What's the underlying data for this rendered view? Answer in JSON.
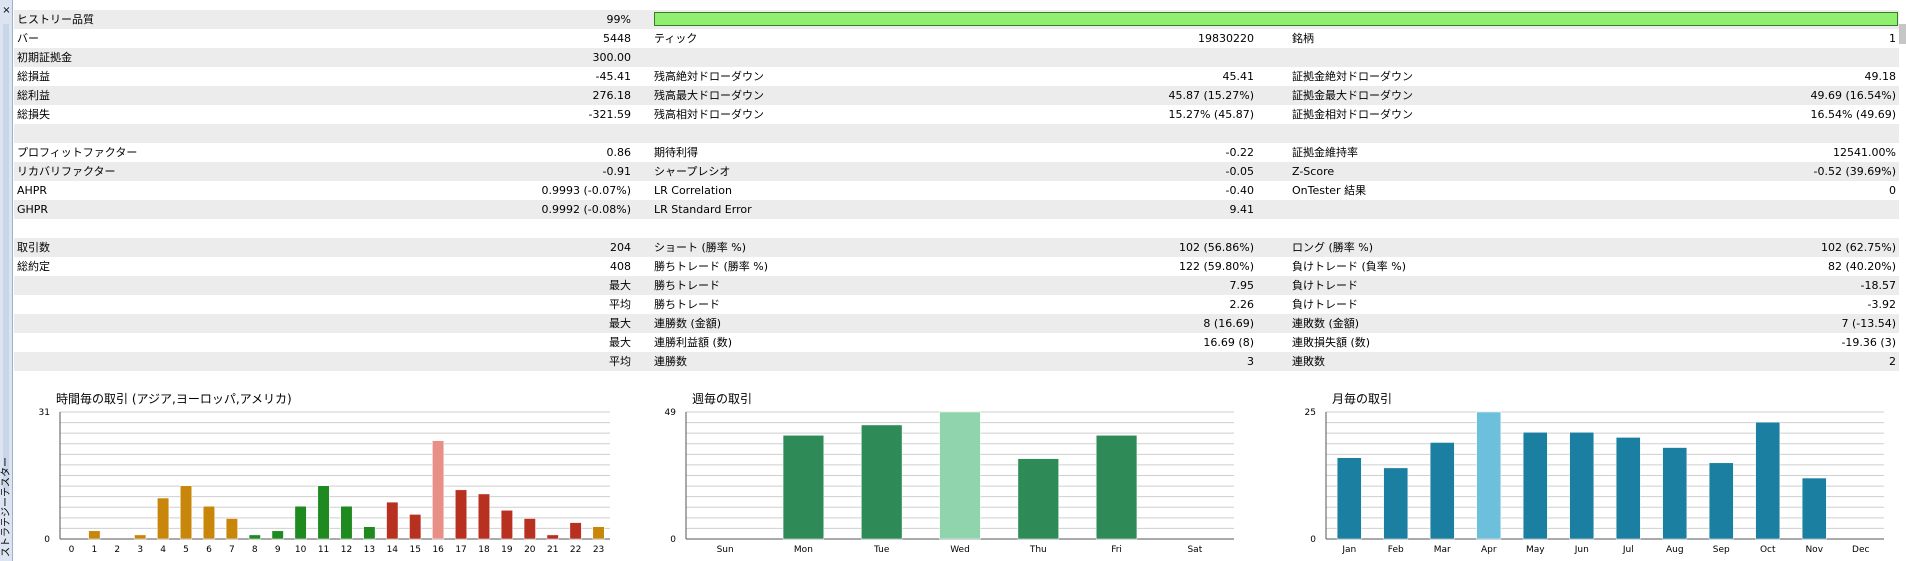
{
  "panel": {
    "title": "ストラテジーテスター",
    "close": "×"
  },
  "stats": [
    {
      "cols": [
        {
          "label": "ヒストリー品質",
          "value": "99%"
        },
        {
          "bar": 0.99
        },
        null
      ]
    },
    {
      "cols": [
        {
          "label": "バー",
          "value": "5448"
        },
        {
          "label": "ティック",
          "value": "19830220"
        },
        {
          "label": "銘柄",
          "value": "1"
        }
      ]
    },
    {
      "cols": [
        {
          "label": "初期証拠金",
          "value": "300.00"
        },
        null,
        null
      ]
    },
    {
      "cols": [
        {
          "label": "総損益",
          "value": "-45.41"
        },
        {
          "label": "残高絶対ドローダウン",
          "value": "45.41"
        },
        {
          "label": "証拠金絶対ドローダウン",
          "value": "49.18"
        }
      ]
    },
    {
      "cols": [
        {
          "label": "総利益",
          "value": "276.18"
        },
        {
          "label": "残高最大ドローダウン",
          "value": "45.87 (15.27%)"
        },
        {
          "label": "証拠金最大ドローダウン",
          "value": "49.69 (16.54%)"
        }
      ]
    },
    {
      "cols": [
        {
          "label": "総損失",
          "value": "-321.59"
        },
        {
          "label": "残高相対ドローダウン",
          "value": "15.27% (45.87)"
        },
        {
          "label": "証拠金相対ドローダウン",
          "value": "16.54% (49.69)"
        }
      ]
    },
    {
      "cols": [
        null,
        null,
        null
      ]
    },
    {
      "cols": [
        {
          "label": "プロフィットファクター",
          "value": "0.86"
        },
        {
          "label": "期待利得",
          "value": "-0.22"
        },
        {
          "label": "証拠金維持率",
          "value": "12541.00%"
        }
      ]
    },
    {
      "cols": [
        {
          "label": "リカバリファクター",
          "value": "-0.91"
        },
        {
          "label": "シャープレシオ",
          "value": "-0.05"
        },
        {
          "label": "Z-Score",
          "value": "-0.52 (39.69%)"
        }
      ]
    },
    {
      "cols": [
        {
          "label": "AHPR",
          "value": "0.9993 (-0.07%)"
        },
        {
          "label": "LR Correlation",
          "value": "-0.40"
        },
        {
          "label": "OnTester 結果",
          "value": "0"
        }
      ]
    },
    {
      "cols": [
        {
          "label": "GHPR",
          "value": "0.9992 (-0.08%)"
        },
        {
          "label": "LR Standard Error",
          "value": "9.41"
        },
        null
      ]
    },
    {
      "cols": [
        null,
        null,
        null
      ]
    },
    {
      "cols": [
        {
          "label": "取引数",
          "value": "204"
        },
        {
          "label": "ショート (勝率 %)",
          "value": "102 (56.86%)"
        },
        {
          "label": "ロング (勝率 %)",
          "value": "102 (62.75%)"
        }
      ]
    },
    {
      "cols": [
        {
          "label": "総約定",
          "value": "408"
        },
        {
          "label": "勝ちトレード (勝率 %)",
          "value": "122 (59.80%)"
        },
        {
          "label": "負けトレード (負率 %)",
          "value": "82 (40.20%)"
        }
      ]
    },
    {
      "cols": [
        {
          "rlabel": "最大"
        },
        {
          "label": "勝ちトレード",
          "value": "7.95"
        },
        {
          "label": "負けトレード",
          "value": "-18.57"
        }
      ]
    },
    {
      "cols": [
        {
          "rlabel": "平均"
        },
        {
          "label": "勝ちトレード",
          "value": "2.26"
        },
        {
          "label": "負けトレード",
          "value": "-3.92"
        }
      ]
    },
    {
      "cols": [
        {
          "rlabel": "最大"
        },
        {
          "label": "連勝数 (金額)",
          "value": "8 (16.69)"
        },
        {
          "label": "連敗数 (金額)",
          "value": "7 (-13.54)"
        }
      ]
    },
    {
      "cols": [
        {
          "rlabel": "最大"
        },
        {
          "label": "連勝利益額 (数)",
          "value": "16.69 (8)"
        },
        {
          "label": "連敗損失額 (数)",
          "value": "-19.36 (3)"
        }
      ]
    },
    {
      "cols": [
        {
          "rlabel": "平均"
        },
        {
          "label": "連勝数",
          "value": "3"
        },
        {
          "label": "連敗数",
          "value": "2"
        }
      ]
    },
    {
      "cols": [
        null,
        null,
        null
      ]
    }
  ],
  "chart_data": [
    {
      "type": "bar",
      "title": "時間毎の取引 (アジア,ヨーロッパ,アメリカ)",
      "categories": [
        "0",
        "1",
        "2",
        "3",
        "4",
        "5",
        "6",
        "7",
        "8",
        "9",
        "10",
        "11",
        "12",
        "13",
        "14",
        "15",
        "16",
        "17",
        "18",
        "19",
        "20",
        "21",
        "22",
        "23"
      ],
      "values": [
        0,
        2,
        0,
        1,
        10,
        13,
        8,
        5,
        1,
        2,
        8,
        13,
        8,
        3,
        9,
        6,
        24,
        12,
        11,
        7,
        5,
        1,
        4,
        3
      ],
      "ylim": [
        0,
        31
      ],
      "yticks": [
        "0",
        "31"
      ],
      "colors": [
        "#c8860a",
        "#c8860a",
        "#c8860a",
        "#c8860a",
        "#c8860a",
        "#c8860a",
        "#c8860a",
        "#c8860a",
        "#1f8a1f",
        "#1f8a1f",
        "#1f8a1f",
        "#1f8a1f",
        "#1f8a1f",
        "#1f8a1f",
        "#b83020",
        "#b83020",
        "#e89088",
        "#b83020",
        "#b83020",
        "#b83020",
        "#b83020",
        "#b83020",
        "#b83020",
        "#c8860a"
      ],
      "grid": true
    },
    {
      "type": "bar",
      "title": "週毎の取引",
      "categories": [
        "Sun",
        "Mon",
        "Tue",
        "Wed",
        "Thu",
        "Fri",
        "Sat"
      ],
      "values": [
        0,
        40,
        44,
        49,
        31,
        40,
        0
      ],
      "ylim": [
        0,
        49
      ],
      "yticks": [
        "0",
        "49"
      ],
      "colors": [
        "#2e8b57",
        "#2e8b57",
        "#2e8b57",
        "#8fd4ad",
        "#2e8b57",
        "#2e8b57",
        "#2e8b57"
      ],
      "grid": true
    },
    {
      "type": "bar",
      "title": "月毎の取引",
      "categories": [
        "Jan",
        "Feb",
        "Mar",
        "Apr",
        "May",
        "Jun",
        "Jul",
        "Aug",
        "Sep",
        "Oct",
        "Nov",
        "Dec"
      ],
      "values": [
        16,
        14,
        19,
        25,
        21,
        21,
        20,
        18,
        15,
        23,
        12,
        0
      ],
      "ylim": [
        0,
        25
      ],
      "yticks": [
        "0",
        "25"
      ],
      "colors": [
        "#1a7fa0",
        "#1a7fa0",
        "#1a7fa0",
        "#6cc0dc",
        "#1a7fa0",
        "#1a7fa0",
        "#1a7fa0",
        "#1a7fa0",
        "#1a7fa0",
        "#1a7fa0",
        "#1a7fa0",
        "#1a7fa0"
      ],
      "grid": true
    }
  ]
}
